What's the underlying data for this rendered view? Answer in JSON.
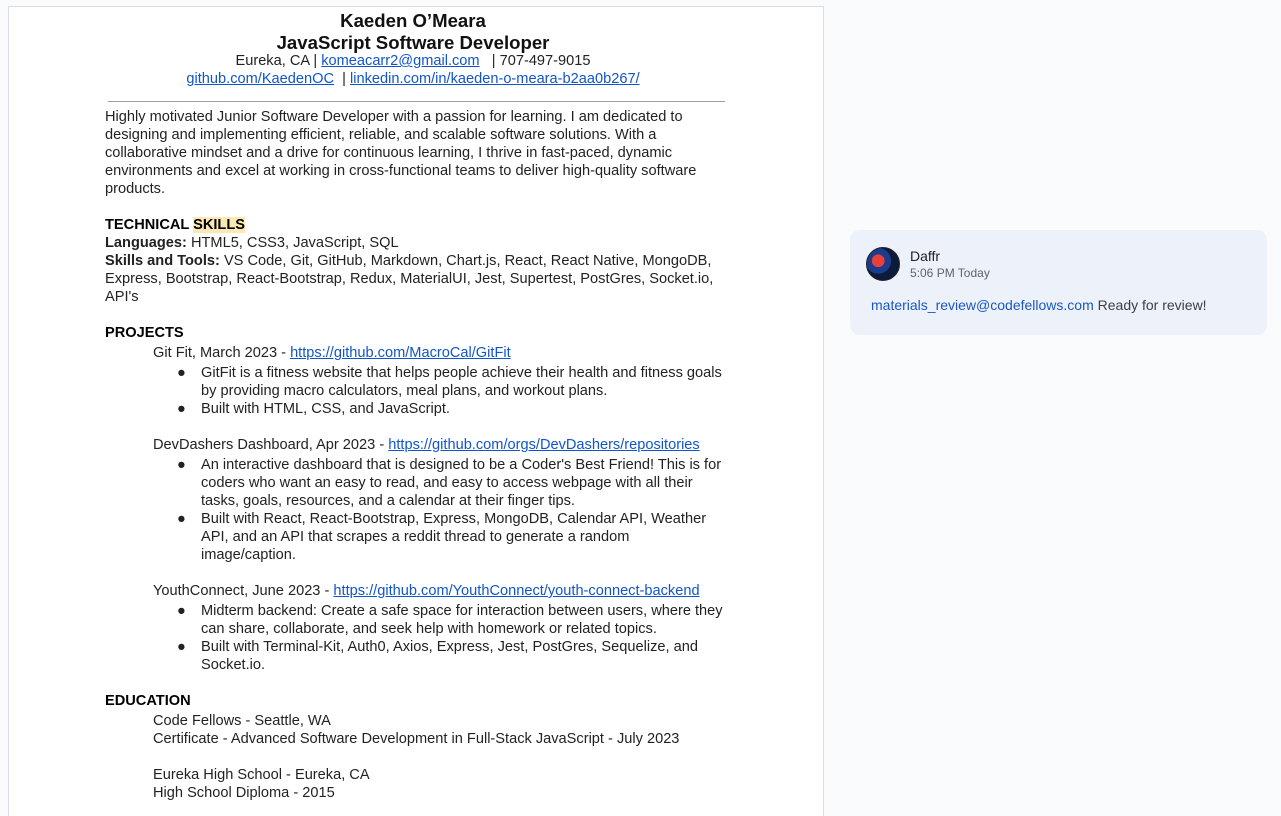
{
  "resume": {
    "name": "Kaeden O’Meara",
    "title": "JavaScript Software Developer",
    "location": "Eureka, CA |",
    "email": "komeacarr2@gmail.com",
    "phone": "| 707-497-9015",
    "github": "github.com/KaedenOC",
    "linkedin_sep": "|",
    "linkedin": "linkedin.com/in/kaeden-o-meara-b2aa0b267/",
    "summary": "Highly motivated Junior Software Developer with a passion for learning. I am dedicated to designing and implementing efficient, reliable, and scalable software solutions. With a collaborative mindset and a drive for continuous learning, I thrive in fast-paced, dynamic environments and excel at working in cross-functional teams to deliver high-quality software products.",
    "skills_heading_a": "TECHNICAL ",
    "skills_heading_b": "SKILLS",
    "languages_label": "Languages:",
    "languages": " HTML5, CSS3, JavaScript, SQL",
    "tools_label": "Skills and Tools:",
    "tools_line1": " VS Code, Git, GitHub, Markdown, Chart.js, React, React Native, MongoDB,",
    "tools_line2": "Express, Bootstrap, React-Bootstrap, Redux, MaterialUI, Jest, Supertest, PostGres, Socket.io,",
    "tools_line3": "API's",
    "projects_heading": "PROJECTS",
    "projects": [
      {
        "title": "Git Fit, March 2023 - ",
        "url": "https://github.com/MacroCal/GitFit",
        "bullets": [
          [
            "GitFit is a fitness website that helps people achieve their health and fitness goals",
            "by providing macro calculators, meal plans, and workout plans."
          ],
          [
            "Built with HTML, CSS, and JavaScript."
          ]
        ]
      },
      {
        "title": "DevDashers Dashboard, Apr 2023 - ",
        "url": "https://github.com/orgs/DevDashers/repositories",
        "bullets": [
          [
            "An interactive dashboard that is designed to be a Coder's Best Friend! This is for",
            "coders who want an easy to read, and easy to access webpage with all their",
            "tasks, goals, resources, and a calendar at their finger tips."
          ],
          [
            "Built with React, React-Bootstrap, Express, MongoDB, Calendar API, Weather",
            "API, and an API that scrapes a reddit thread to generate a random",
            "image/caption."
          ]
        ]
      },
      {
        "title": "YouthConnect, June 2023 - ",
        "url": "https://github.com/YouthConnect/youth-connect-backend",
        "bullets": [
          [
            "Midterm backend: Create a safe space for interaction between users, where they",
            "can share, collaborate, and seek help with homework or related topics."
          ],
          [
            "Built with Terminal-Kit, Auth0, Axios, Express, Jest, PostGres, Sequelize, and",
            "Socket.io."
          ]
        ]
      }
    ],
    "education_heading": "EDUCATION",
    "education": [
      "Code Fellows - Seattle, WA",
      "Certificate - Advanced Software Development in Full-Stack JavaScript - July 2023",
      "",
      "Eureka High School - Eureka, CA",
      "High School Diploma - 2015"
    ]
  },
  "comment": {
    "author": "Daffr",
    "time": "5:06 PM Today",
    "mention": "materials_review@codefellows.com",
    "text": " Ready for review!"
  },
  "bullet_glyph": "●"
}
